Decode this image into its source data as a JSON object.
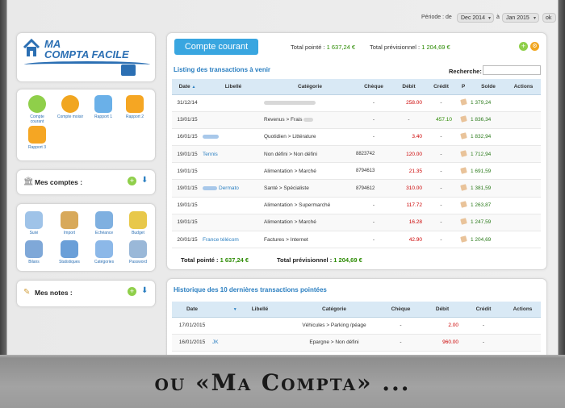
{
  "period": {
    "label": "Période : de",
    "from": "Dec 2014",
    "to_label": "à",
    "to": "Jan 2015",
    "ok": "ok"
  },
  "logo": {
    "line1": "MA",
    "line2": "COMPTA FACILE"
  },
  "apps_top": [
    "Compte courant",
    "Compte moisir",
    "Rapport 1",
    "Rapport 2",
    "Rapport 3"
  ],
  "mes_comptes": "Mes comptes :",
  "tools": [
    "Suivi",
    "Import",
    "Echéance",
    "Budget",
    "Bilans",
    "Statistiques",
    "Catégories",
    "Password"
  ],
  "mes_notes": "Mes notes :",
  "account": {
    "badge": "Compte courant",
    "total_pointe": "Total pointé :",
    "total_pointe_val": "1 637,24 €",
    "total_prev": "Total prévisionnel :",
    "total_prev_val": "1 204,69 €"
  },
  "listing": {
    "title": "Listing des transactions à venir",
    "search_label": "Recherche:"
  },
  "headers": [
    "Date",
    "Libellé",
    "Catégorie",
    "Chèque",
    "Débit",
    "Crédit",
    "P",
    "Solde",
    "Actions"
  ],
  "rows": [
    {
      "date": "31/12/14",
      "libelle": "",
      "cat": "",
      "cheque": "-",
      "debit": "258.00",
      "credit": "-",
      "solde": "1 379,24"
    },
    {
      "date": "13/01/15",
      "libelle": "",
      "cat": "Revenus > Frais",
      "cheque": "-",
      "debit": "-",
      "credit": "457.10",
      "solde": "1 836,34"
    },
    {
      "date": "16/01/15",
      "libelle": "",
      "cat": "Quotidien > Littérature",
      "cheque": "-",
      "debit": "3.40",
      "credit": "-",
      "solde": "1 832,94"
    },
    {
      "date": "19/01/15",
      "libelle": "Tennis",
      "cat": "Non défini > Non défini",
      "cheque": "8823742",
      "debit": "120.00",
      "credit": "-",
      "solde": "1 712,94"
    },
    {
      "date": "19/01/15",
      "libelle": "",
      "cat": "Alimentation > Marché",
      "cheque": "8794613",
      "debit": "21.35",
      "credit": "-",
      "solde": "1 691,59"
    },
    {
      "date": "19/01/15",
      "libelle": "Dermato",
      "cat": "Santé > Spécialiste",
      "cheque": "8794612",
      "debit": "310.00",
      "credit": "-",
      "solde": "1 381,59"
    },
    {
      "date": "19/01/15",
      "libelle": "",
      "cat": "Alimentation > Supermarché",
      "cheque": "-",
      "debit": "117.72",
      "credit": "-",
      "solde": "1 263,87"
    },
    {
      "date": "19/01/15",
      "libelle": "",
      "cat": "Alimentation > Marché",
      "cheque": "-",
      "debit": "16.28",
      "credit": "-",
      "solde": "1 247,59"
    },
    {
      "date": "20/01/15",
      "libelle": "France télécom",
      "cat": "Factures > Internet",
      "cheque": "-",
      "debit": "42.90",
      "credit": "-",
      "solde": "1 204,69"
    }
  ],
  "footer": {
    "pointe": "Total pointé :",
    "pointe_val": "1 637,24 €",
    "prev": "Total prévisionnel :",
    "prev_val": "1 204,69 €"
  },
  "history": {
    "title": "Historique des 10 dernières transactions pointées",
    "headers": [
      "Date",
      "Libellé",
      "Catégorie",
      "Chèque",
      "Débit",
      "Crédit",
      "Actions"
    ],
    "rows": [
      {
        "date": "17/01/2015",
        "libelle": "",
        "cat": "Véhicules > Parking /péage",
        "cheque": "-",
        "debit": "2.00",
        "credit": "-"
      },
      {
        "date": "16/01/2015",
        "libelle": "JK",
        "cat": "Epargne > Non défini",
        "cheque": "-",
        "debit": "960.00",
        "credit": "-"
      }
    ]
  },
  "banner": "ou «Ma Compta» ..."
}
